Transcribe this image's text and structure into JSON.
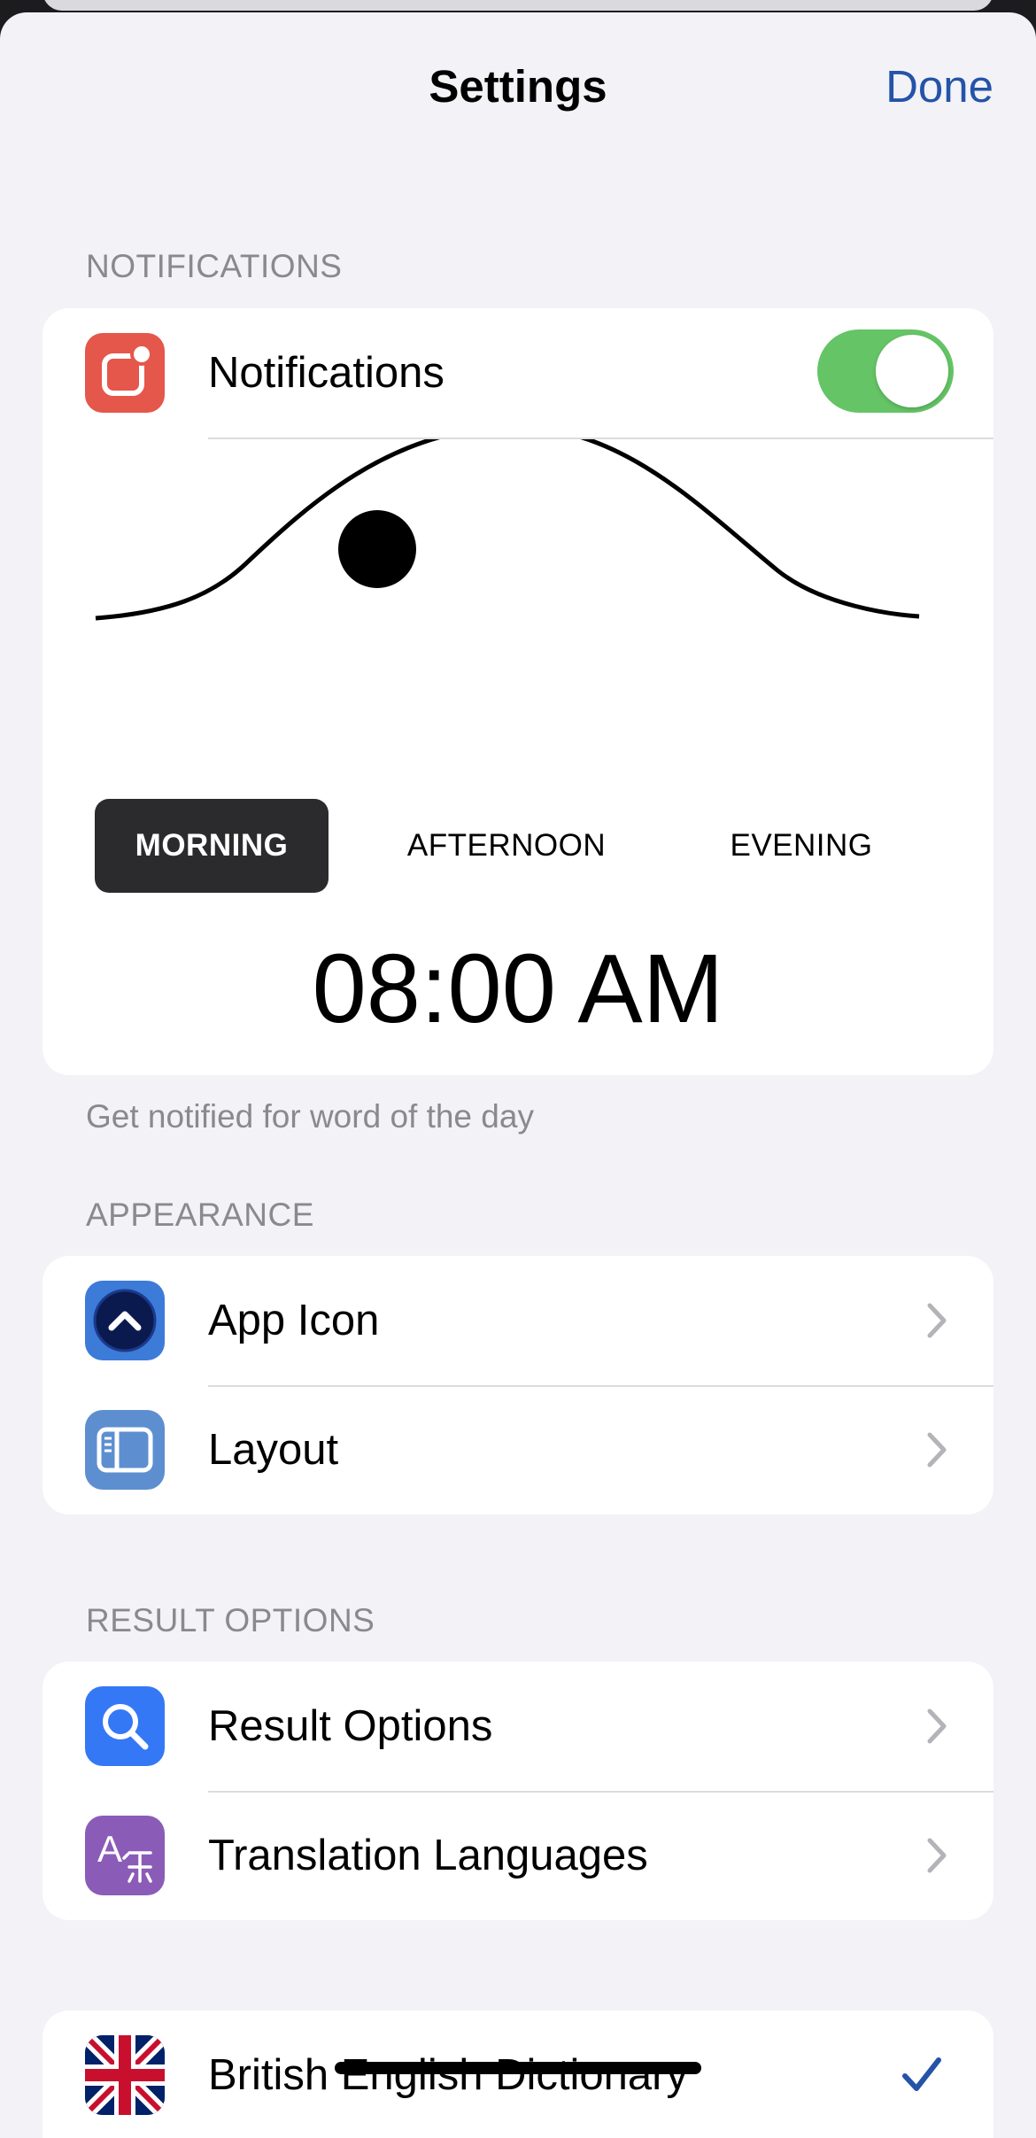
{
  "header": {
    "title": "Settings",
    "done_label": "Done"
  },
  "sections": {
    "notifications": {
      "header": "NOTIFICATIONS",
      "row_label": "Notifications",
      "toggle_on": true,
      "times_of_day": [
        "MORNING",
        "AFTERNOON",
        "EVENING"
      ],
      "selected_time_of_day": "MORNING",
      "time": "08:00 AM",
      "footer": "Get notified for word of the day"
    },
    "appearance": {
      "header": "APPEARANCE",
      "items": [
        {
          "label": "App Icon",
          "icon": "chevron-up-app-icon"
        },
        {
          "label": "Layout",
          "icon": "sidebar-layout-icon"
        }
      ]
    },
    "result_options": {
      "header": "RESULT OPTIONS",
      "items": [
        {
          "label": "Result Options",
          "icon": "search-icon"
        },
        {
          "label": "Translation Languages",
          "icon": "translate-icon"
        }
      ]
    },
    "dictionary": {
      "items": [
        {
          "label": "British English Dictionary",
          "icon": "uk-flag-icon",
          "checked": true
        }
      ]
    }
  },
  "colors": {
    "accent": "#2453a8",
    "toggle_on": "#65c466",
    "notifications_icon": "#e5574a",
    "app_icon_bg": "#3c7bd8",
    "layout_icon_bg": "#5d8fd0",
    "search_icon_bg": "#3478f6",
    "translate_icon_bg": "#8a5cb8"
  }
}
